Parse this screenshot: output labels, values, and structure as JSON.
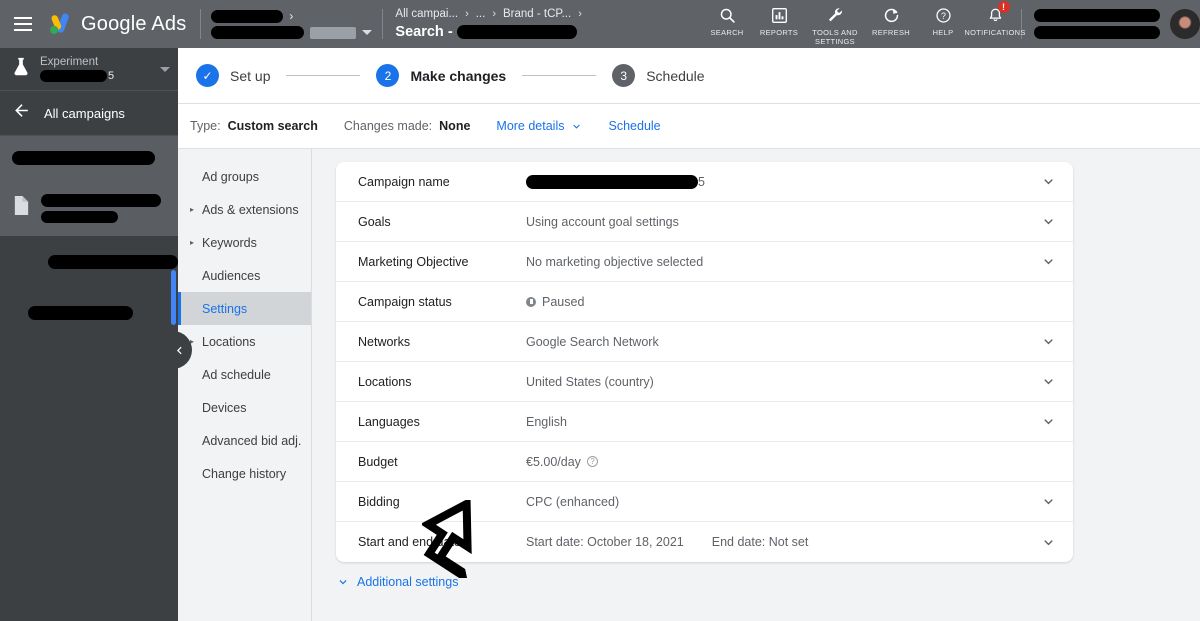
{
  "topbar": {
    "menu_icon": "hamburger-icon",
    "brand": "Google Ads",
    "account_caret": "caret-down-icon",
    "breadcrumb": {
      "item1": "All campai...",
      "sep1": "›",
      "item2": "...",
      "sep2": "›",
      "item3": "Brand - tCP...",
      "sep3": "›",
      "current_prefix": "Search -"
    },
    "tools": [
      {
        "label": "Search",
        "icon": "search-icon"
      },
      {
        "label": "Reports",
        "icon": "bar-chart-icon"
      },
      {
        "label": "Tools and settings",
        "icon": "wrench-icon"
      },
      {
        "label": "Refresh",
        "icon": "refresh-icon"
      },
      {
        "label": "Help",
        "icon": "question-mark-icon"
      },
      {
        "label": "Notifications",
        "icon": "bell-icon",
        "badge": "!"
      }
    ]
  },
  "leftpanel": {
    "experiment_label": "Experiment",
    "experiment_suffix": "5",
    "experiment_icon": "flask-icon",
    "back_label": "All campaigns",
    "back_icon": "arrow-left-icon",
    "doc_icon": "document-icon",
    "collapse_icon": "chevron-left-icon"
  },
  "stepper": {
    "steps": [
      {
        "marker": "✓",
        "label": "Set up",
        "state": "done"
      },
      {
        "marker": "2",
        "label": "Make changes",
        "state": "active"
      },
      {
        "marker": "3",
        "label": "Schedule",
        "state": "todo"
      }
    ]
  },
  "infobar": {
    "type_key": "Type:",
    "type_value": "Custom search",
    "changes_key": "Changes made:",
    "changes_value": "None",
    "more_details": "More details",
    "more_details_icon": "chevron-down-icon",
    "schedule_link": "Schedule"
  },
  "navcol": {
    "items": [
      {
        "label": "Ad groups",
        "expandable": false,
        "selected": false
      },
      {
        "label": "Ads & extensions",
        "expandable": true,
        "selected": false
      },
      {
        "label": "Keywords",
        "expandable": true,
        "selected": false
      },
      {
        "label": "Audiences",
        "expandable": false,
        "selected": false
      },
      {
        "label": "Settings",
        "expandable": false,
        "selected": true
      },
      {
        "label": "Locations",
        "expandable": true,
        "selected": false
      },
      {
        "label": "Ad schedule",
        "expandable": false,
        "selected": false
      },
      {
        "label": "Devices",
        "expandable": false,
        "selected": false
      },
      {
        "label": "Advanced bid adj.",
        "expandable": false,
        "selected": false
      },
      {
        "label": "Change history",
        "expandable": false,
        "selected": false
      }
    ]
  },
  "settings": {
    "rows": [
      {
        "label": "Campaign name",
        "value": "",
        "redacted": true,
        "redact_suffix": "5",
        "chevron": true
      },
      {
        "label": "Goals",
        "value": "Using account goal settings",
        "chevron": true
      },
      {
        "label": "Marketing Objective",
        "value": "No marketing objective selected",
        "chevron": true
      },
      {
        "label": "Campaign status",
        "value": "Paused",
        "status_icon": "pause-circle-icon",
        "chevron": false
      },
      {
        "label": "Networks",
        "value": "Google Search Network",
        "chevron": true
      },
      {
        "label": "Locations",
        "value": "United States (country)",
        "chevron": true
      },
      {
        "label": "Languages",
        "value": "English",
        "chevron": true
      },
      {
        "label": "Budget",
        "value": "€5.00/day",
        "help_icon": "help-circle-icon",
        "chevron": false
      },
      {
        "label": "Bidding",
        "value": "CPC (enhanced)",
        "chevron": true
      },
      {
        "label": "Start and end dates",
        "value": "Start date: October 18, 2021",
        "value2": "End date: Not set",
        "chevron": true
      }
    ],
    "additional_label": "Additional settings",
    "additional_icon": "chevron-down-icon"
  },
  "annotation": {
    "icon": "arrow-up-right-annotation"
  },
  "colors": {
    "topbar_bg": "#5f6368",
    "sidebar_bg": "#3c4043",
    "accent_blue": "#1a73e8",
    "badge_red": "#d93025",
    "panel_bg": "#f1f3f4"
  }
}
